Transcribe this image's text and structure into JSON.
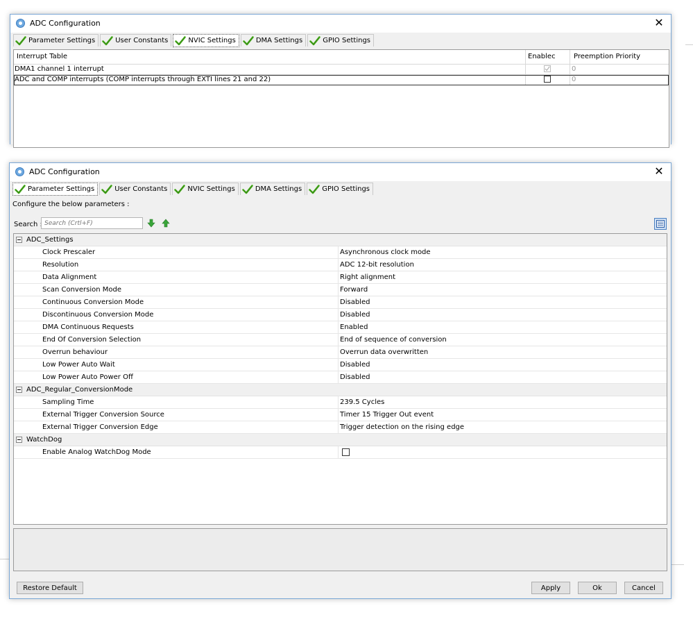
{
  "colors": {
    "window_border": "#7aa7d6",
    "check_green": "#4caf20",
    "dialog_bg": "#f0f0f0"
  },
  "top_dialog": {
    "title": "ADC Configuration",
    "close_glyph": "✕",
    "tabs": [
      {
        "label": "Parameter Settings",
        "icon": "check-icon"
      },
      {
        "label": "User Constants",
        "icon": "check-icon"
      },
      {
        "label": "NVIC Settings",
        "icon": "check-icon"
      },
      {
        "label": "DMA Settings",
        "icon": "check-icon"
      },
      {
        "label": "GPIO Settings",
        "icon": "check-icon"
      }
    ],
    "active_tab": "NVIC Settings",
    "table": {
      "headers": [
        "Interrupt Table",
        "Enablec",
        "Preemption Priority"
      ],
      "rows": [
        {
          "name": "DMA1 channel 1 interrupt",
          "enabled": true,
          "editable": false,
          "priority": "0"
        },
        {
          "name": "ADC and COMP interrupts (COMP interrupts through EXTI lines 21 and 22)",
          "enabled": false,
          "editable": true,
          "priority": "0"
        }
      ]
    }
  },
  "main_dialog": {
    "title": "ADC Configuration",
    "close_glyph": "✕",
    "tabs": [
      {
        "label": "Parameter Settings",
        "icon": "check-icon"
      },
      {
        "label": "User Constants",
        "icon": "check-icon"
      },
      {
        "label": "NVIC Settings",
        "icon": "check-icon"
      },
      {
        "label": "DMA Settings",
        "icon": "check-icon"
      },
      {
        "label": "GPIO Settings",
        "icon": "check-icon"
      }
    ],
    "active_tab": "Parameter Settings",
    "configure_label": "Configure the below parameters :",
    "search": {
      "label": "Search :",
      "placeholder": "Search (Crtl+F)",
      "value": ""
    },
    "groups": [
      {
        "name": "ADC_Settings",
        "params": [
          {
            "name": "Clock Prescaler",
            "value": "Asynchronous clock mode"
          },
          {
            "name": "Resolution",
            "value": "ADC 12-bit resolution"
          },
          {
            "name": "Data Alignment",
            "value": "Right alignment"
          },
          {
            "name": "Scan Conversion Mode",
            "value": "Forward"
          },
          {
            "name": "Continuous Conversion Mode",
            "value": "Disabled"
          },
          {
            "name": "Discontinuous Conversion Mode",
            "value": "Disabled"
          },
          {
            "name": "DMA Continuous Requests",
            "value": "Enabled"
          },
          {
            "name": "End Of Conversion Selection",
            "value": "End of sequence of conversion"
          },
          {
            "name": "Overrun behaviour",
            "value": "Overrun data overwritten"
          },
          {
            "name": "Low Power Auto Wait",
            "value": "Disabled"
          },
          {
            "name": "Low Power Auto Power Off",
            "value": "Disabled"
          }
        ]
      },
      {
        "name": "ADC_Regular_ConversionMode",
        "params": [
          {
            "name": "Sampling Time",
            "value": "239.5 Cycles"
          },
          {
            "name": "External Trigger Conversion Source",
            "value": "Timer 15 Trigger Out event"
          },
          {
            "name": "External Trigger Conversion Edge",
            "value": "Trigger detection on the rising edge"
          }
        ]
      },
      {
        "name": "WatchDog",
        "params": [
          {
            "name": "Enable Analog WatchDog Mode",
            "value": "",
            "checkbox": true,
            "checked": false
          }
        ]
      }
    ],
    "buttons": {
      "restore": "Restore Default",
      "apply": "Apply",
      "ok": "Ok",
      "cancel": "Cancel"
    }
  }
}
